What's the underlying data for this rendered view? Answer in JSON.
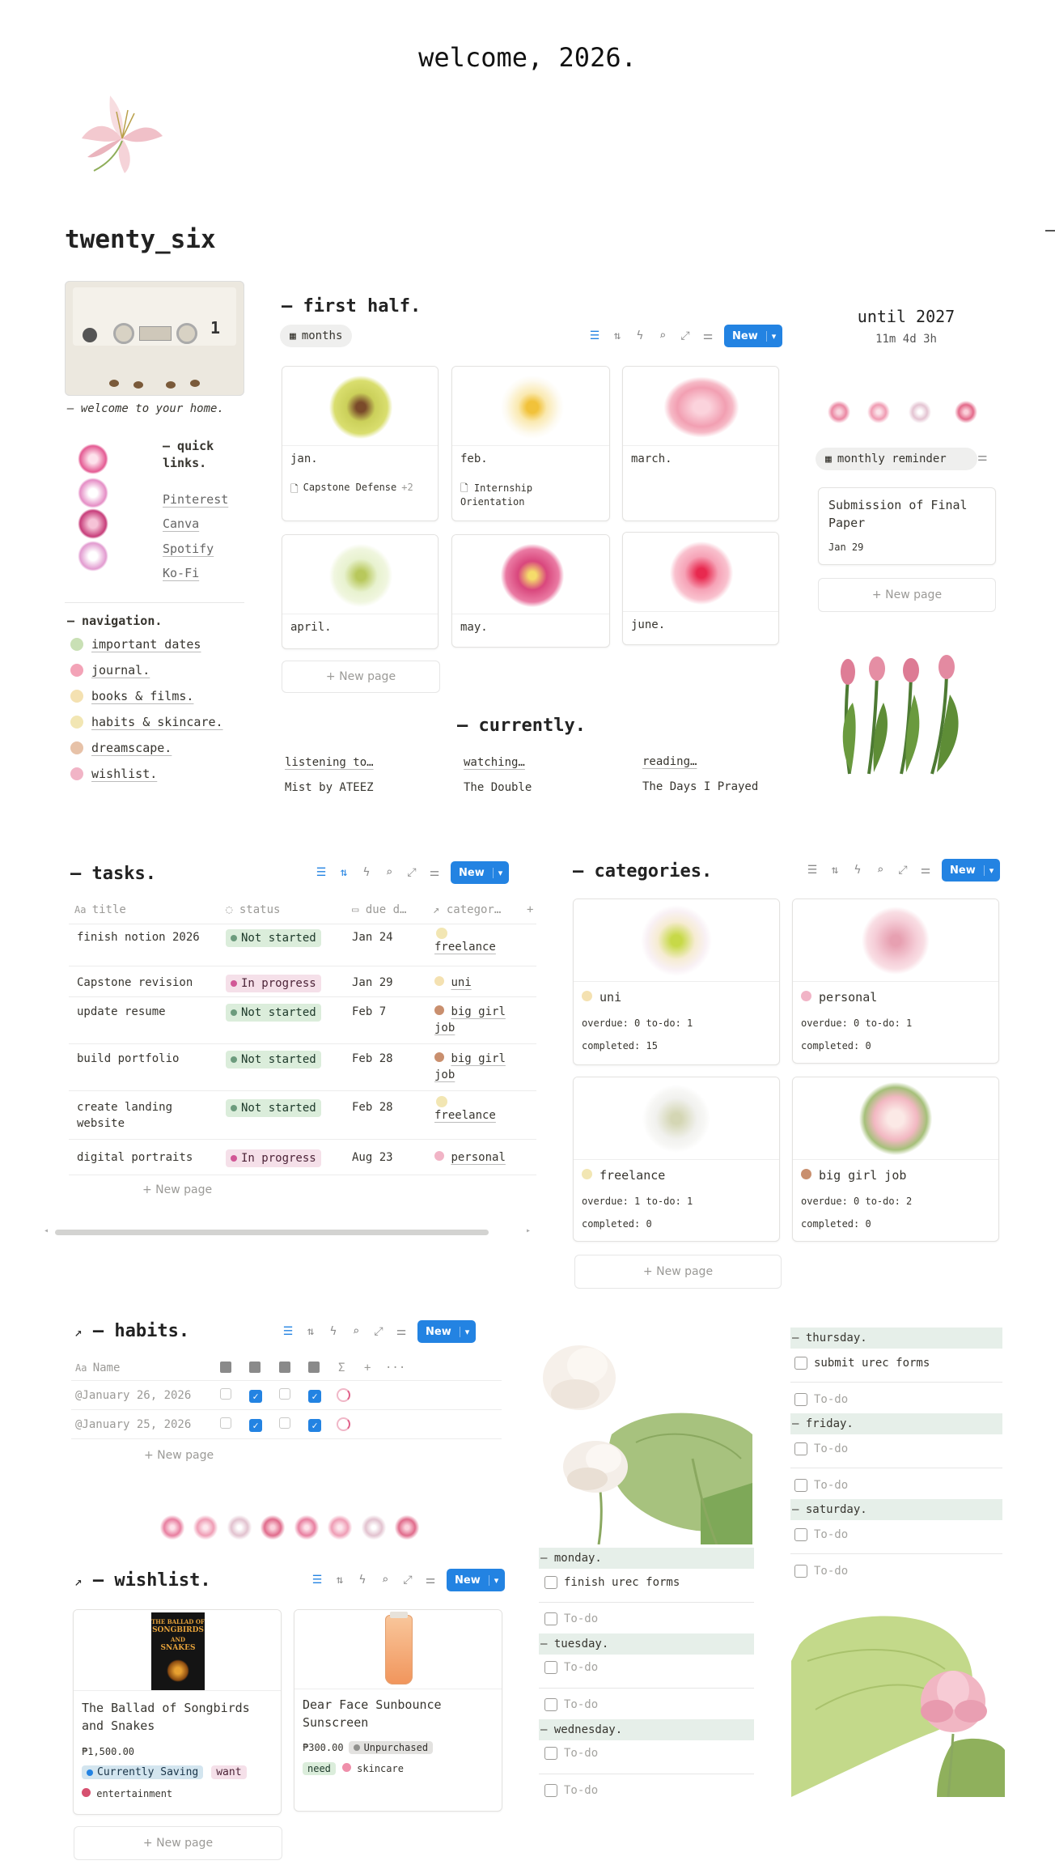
{
  "header": {
    "welcome": "welcome, 2026.",
    "page_title": "twenty_six"
  },
  "sidebar": {
    "tagline": "— welcome to your home.",
    "quick_links_title_1": "— quick",
    "quick_links_title_2": "links.",
    "quick_links": [
      "Pinterest",
      "Canva",
      "Spotify",
      "Ko-Fi"
    ],
    "nav_title": "— navigation.",
    "nav_items": [
      "important dates",
      "journal.",
      "books & films.",
      "habits & skincare.",
      "dreamscape.",
      "wishlist."
    ]
  },
  "first_half": {
    "title": "— first half.",
    "view_label": "months",
    "new_label": "New",
    "cards": [
      {
        "title": "jan.",
        "sub": "Capstone Defense",
        "extra": "+2"
      },
      {
        "title": "feb.",
        "sub": "Internship Orientation"
      },
      {
        "title": "march."
      },
      {
        "title": "april."
      },
      {
        "title": "may."
      },
      {
        "title": "june."
      }
    ],
    "new_page": "+ New page"
  },
  "countdown": {
    "title": "until 2027",
    "value": "11m 4d 3h",
    "view_label": "monthly reminder",
    "card_title": "Submission of Final Paper",
    "card_date": "Jan 29",
    "new_page": "+ New page"
  },
  "currently": {
    "title": "— currently.",
    "items": [
      {
        "label": "listening to…",
        "value": "Mist by ATEEZ"
      },
      {
        "label": "watching…",
        "value": "The Double"
      },
      {
        "label": "reading…",
        "value": "The Days I Prayed"
      }
    ]
  },
  "tasks": {
    "title": "— tasks.",
    "new_label": "New",
    "columns": [
      "title",
      "status",
      "due d…",
      "categor…"
    ],
    "rows": [
      {
        "title": "finish notion 2026",
        "status": "Not started",
        "due": "Jan 24",
        "category": "freelance"
      },
      {
        "title": "Capstone revision",
        "status": "In progress",
        "due": "Jan 29",
        "category": "uni"
      },
      {
        "title": "update resume",
        "status": "Not started",
        "due": "Feb 7",
        "category": "big girl job"
      },
      {
        "title": "build portfolio",
        "status": "Not started",
        "due": "Feb 28",
        "category": "big girl job"
      },
      {
        "title": "create landing website",
        "status": "Not started",
        "due": "Feb 28",
        "category": "freelance"
      },
      {
        "title": "digital portraits",
        "status": "In progress",
        "due": "Aug 23",
        "category": "personal"
      }
    ],
    "new_page": "+ New page"
  },
  "categories": {
    "title": "— categories.",
    "new_label": "New",
    "cards": [
      {
        "name": "uni",
        "stats1": "overdue: 0 to-do: 1",
        "stats2": "completed: 15"
      },
      {
        "name": "personal",
        "stats1": "overdue: 0 to-do: 1",
        "stats2": "completed: 0"
      },
      {
        "name": "freelance",
        "stats1": "overdue: 1 to-do: 1",
        "stats2": "completed: 0"
      },
      {
        "name": "big girl job",
        "stats1": "overdue: 0 to-do: 2",
        "stats2": "completed: 0"
      }
    ],
    "new_page": "+ New page"
  },
  "habits": {
    "title": "— habits.",
    "new_label": "New",
    "name_col": "Name",
    "rows": [
      {
        "name": "@January 26, 2026",
        "checks": [
          false,
          true,
          false,
          true
        ]
      },
      {
        "name": "@January 25, 2026",
        "checks": [
          false,
          true,
          false,
          true
        ]
      }
    ],
    "new_page": "+ New page"
  },
  "wishlist": {
    "title": "— wishlist.",
    "new_label": "New",
    "cards": [
      {
        "title": "The Ballad of Songbirds and Snakes",
        "price": "₱1,500.00",
        "status": "Currently Saving",
        "tag": "want",
        "category": "entertainment",
        "book_text_1": "THE BALLAD OF",
        "book_text_2": "SONGBIRDS",
        "book_text_3": "AND",
        "book_text_4": "SNAKES"
      },
      {
        "title": "Dear Face Sunbounce Sunscreen",
        "price": "₱300.00",
        "status": "Unpurchased",
        "tag": "need",
        "category": "skincare"
      }
    ],
    "new_page": "+ New page"
  },
  "week": {
    "monday": {
      "title": "— monday.",
      "items": [
        "finish urec forms"
      ],
      "placeholder": "To-do"
    },
    "tuesday": {
      "title": "— tuesday.",
      "placeholder": "To-do"
    },
    "wednesday": {
      "title": "— wednesday.",
      "placeholder": "To-do"
    },
    "thursday": {
      "title": "— thursday.",
      "items": [
        "submit urec forms"
      ],
      "placeholder": "To-do"
    },
    "friday": {
      "title": "— friday.",
      "placeholder": "To-do"
    },
    "saturday": {
      "title": "— saturday.",
      "placeholder": "To-do"
    }
  },
  "colors": {
    "accent": "#2383e2",
    "not_started": "#dbeddb",
    "in_progress": "#f5e0e9",
    "day_header": "#e6efe9"
  }
}
